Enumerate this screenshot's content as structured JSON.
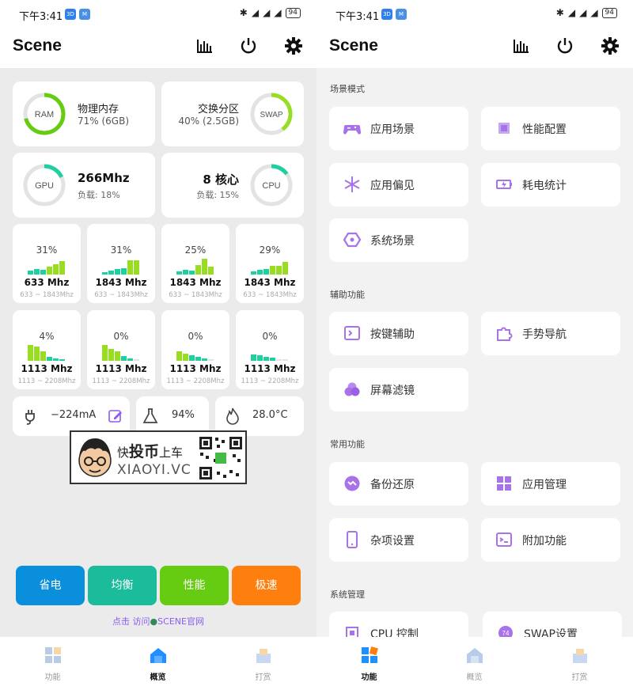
{
  "status": {
    "time": "下午3:41",
    "battery": "94"
  },
  "app": {
    "title": "Scene"
  },
  "overview": {
    "ram": {
      "ring_label": "RAM",
      "title": "物理内存",
      "detail": "71% (6GB)",
      "fraction": 0.71
    },
    "swap": {
      "ring_label": "SWAP",
      "title": "交换分区",
      "detail": "40% (2.5GB)",
      "fraction": 0.4
    },
    "gpu": {
      "ring_label": "GPU",
      "freq": "266Mhz",
      "load": "负载: 18%",
      "fraction": 0.18
    },
    "cpu": {
      "ring_label": "CPU",
      "cores": "8 核心",
      "load": "负载: 15%",
      "fraction": 0.15
    },
    "cores": [
      {
        "pct": "31%",
        "freq": "633 Mhz",
        "range": "633 ~ 1843Mhz"
      },
      {
        "pct": "31%",
        "freq": "1843 Mhz",
        "range": "633 ~ 1843Mhz"
      },
      {
        "pct": "25%",
        "freq": "1843 Mhz",
        "range": "633 ~ 1843Mhz"
      },
      {
        "pct": "29%",
        "freq": "1843 Mhz",
        "range": "633 ~ 1843Mhz"
      },
      {
        "pct": "4%",
        "freq": "1113 Mhz",
        "range": "1113 ~ 2208Mhz"
      },
      {
        "pct": "0%",
        "freq": "1113 Mhz",
        "range": "1113 ~ 2208Mhz"
      },
      {
        "pct": "0%",
        "freq": "1113 Mhz",
        "range": "1113 ~ 2208Mhz"
      },
      {
        "pct": "0%",
        "freq": "1113 Mhz",
        "range": "1113 ~ 2208Mhz"
      }
    ],
    "current": "−224mA",
    "battery_level": "94%",
    "temperature": "28.0°C",
    "modes": [
      "省电",
      "均衡",
      "性能",
      "极速"
    ],
    "mode_colors": [
      "#0a8fdc",
      "#1abc9c",
      "#66cc11",
      "#ff7f0e"
    ],
    "link_prefix": "点击 访问",
    "link_text": "SCENE官网"
  },
  "watermark": {
    "line1a": "快",
    "line1b": "投币",
    "line1c": "上车",
    "line2": "XIAOYI.VC"
  },
  "functions": {
    "sections": [
      {
        "title": "场景模式",
        "items": [
          "应用场景",
          "性能配置",
          "应用偏见",
          "耗电统计",
          "系统场景"
        ]
      },
      {
        "title": "辅助功能",
        "items": [
          "按键辅助",
          "手势导航",
          "屏幕滤镜"
        ]
      },
      {
        "title": "常用功能",
        "items": [
          "备份还原",
          "应用管理",
          "杂项设置",
          "附加功能"
        ]
      },
      {
        "title": "系统管理",
        "items": [
          "CPU 控制",
          "SWAP设置"
        ]
      }
    ]
  },
  "nav": {
    "items": [
      "功能",
      "概览",
      "打赏"
    ]
  },
  "colors": {
    "accent": "#8b5cf6",
    "green": "#66cc11",
    "teal": "#1ecfa0",
    "lime": "#99dd22"
  }
}
